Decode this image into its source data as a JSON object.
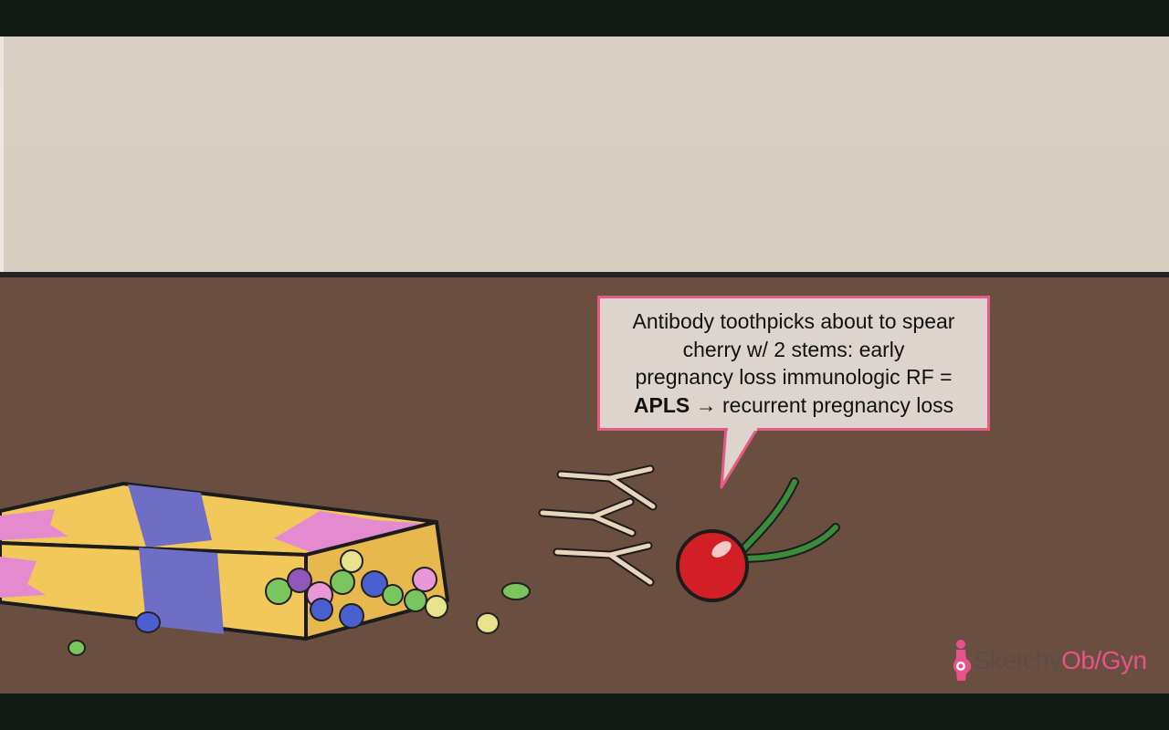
{
  "slide": {
    "callout": {
      "line1": "Antibody toothpicks about to spear",
      "line2": "cherry w/ 2 stems: early",
      "line3": "pregnancy loss immunologic RF =",
      "line4_bold": "APLS",
      "line4_rest": " → recurrent pregnancy loss"
    },
    "logo": {
      "word1": "Sketchy",
      "word2": "Ob/Gyn",
      "icon": "pregnant-figure-icon"
    }
  },
  "colors": {
    "wall": "#d8d0c4",
    "floor": "#6a4f41",
    "callout_border": "#e85a86",
    "cherry": "#d41e25",
    "stem": "#3a8c3a",
    "box_yellow": "#f2c85a",
    "box_purple": "#6f6ec6",
    "box_pink": "#e48bd0"
  }
}
